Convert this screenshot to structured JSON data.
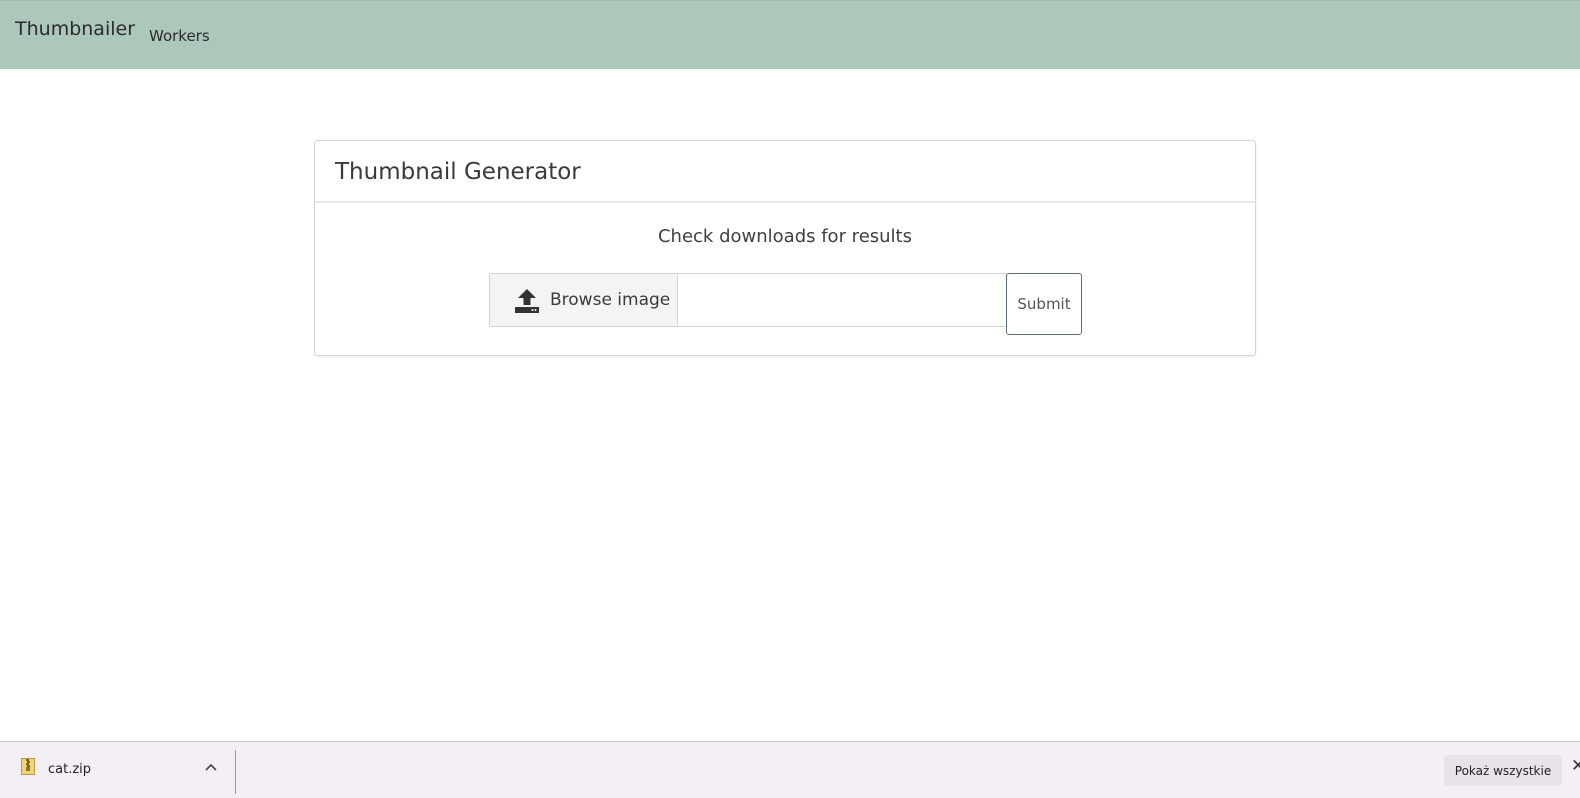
{
  "navbar": {
    "brand": "Thumbnailer",
    "links": [
      "Workers"
    ]
  },
  "card": {
    "title": "Thumbnail Generator",
    "note": "Check downloads for results",
    "browse_label": "Browse image",
    "browse_icon": "upload-icon",
    "file_input_value": "",
    "submit_label": "Submit"
  },
  "download_bar": {
    "file_name": "cat.zip",
    "file_icon": "zip-file-icon",
    "show_all_label": "Pokaż wszystkie",
    "close_glyph": "✕"
  },
  "colors": {
    "navbar_bg": "#abc8bb",
    "download_bar_bg": "#f3eff5"
  }
}
